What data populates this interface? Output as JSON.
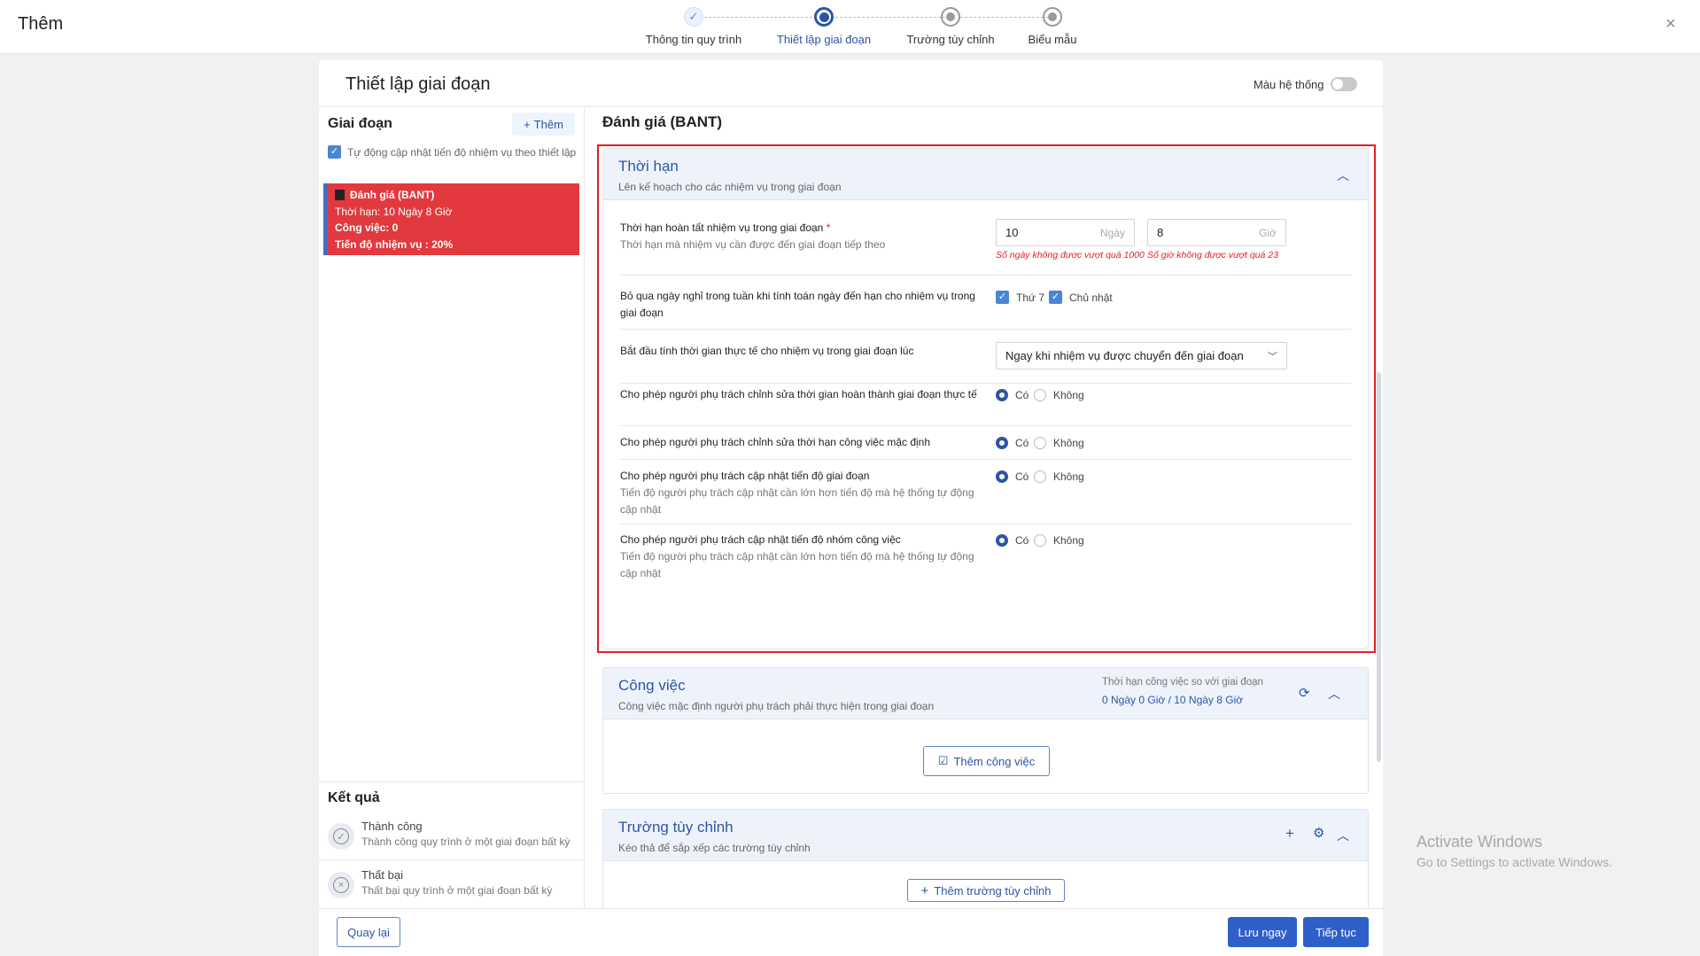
{
  "modal": {
    "title": "Thêm",
    "close": "×"
  },
  "steps": [
    {
      "label": "Thông tin quy trình",
      "state": "done"
    },
    {
      "label": "Thiết lập giai đoạn",
      "state": "active"
    },
    {
      "label": "Trường tùy chỉnh",
      "state": "pending"
    },
    {
      "label": "Biểu mẫu",
      "state": "pending"
    }
  ],
  "card": {
    "title": "Thiết lập giai đoạn",
    "system_color_label": "Màu hệ thống"
  },
  "left": {
    "heading": "Giai đoạn",
    "add_button": "Thêm",
    "add_icon": "+",
    "auto_update_label": "Tự động cập nhật tiến độ nhiệm vụ theo thiết lập",
    "stage": {
      "name": "Đánh giá (BANT)",
      "deadline": "Thời hạn: 10 Ngày 8 Giờ",
      "tasks": "Công việc: 0",
      "progress": "Tiến độ nhiệm vụ :  20%",
      "color": "#e2393e"
    },
    "results": {
      "heading": "Kết quả",
      "success": {
        "title": "Thành công",
        "desc": "Thành công quy trình ở một giai đoạn bất kỳ"
      },
      "fail": {
        "title": "Thất bại",
        "desc": "Thất bại quy trình ở một giai đoạn bất kỳ"
      }
    }
  },
  "stage_title": "Đánh giá (BANT)",
  "deadline_section": {
    "title": "Thời hạn",
    "subtitle": "Lên kế hoạch cho các nhiệm vụ trong giai đoạn",
    "complete_label": "Thời hạn hoàn tất nhiệm vụ trong giai đoạn",
    "required_mark": "*",
    "complete_sub": "Thời hạn mà nhiệm vụ cần được đến giai đoạn tiếp theo",
    "days_value": "10",
    "days_unit": "Ngày",
    "days_error": "Số ngày không được vượt quá 1000",
    "hours_value": "8",
    "hours_unit": "Giờ",
    "hours_error": "Số giờ không được vượt quá 23",
    "skip_label": "Bỏ qua ngày nghỉ trong tuần khi tính toán ngày đến hạn cho nhiệm vụ trong giai đoạn",
    "skip_sat": "Thứ 7",
    "skip_sun": "Chủ nhật",
    "start_label": "Bắt đầu tính thời gian thực tế cho nhiệm vụ trong giai đoạn lúc",
    "start_value": "Ngay khi nhiệm vụ được chuyển đến giai đoạn",
    "yes": "Có",
    "no": "Không",
    "q1": "Cho phép người phụ trách chỉnh sửa thời gian hoàn thành giai đoạn thực tế",
    "q2": "Cho phép người phụ trách chỉnh sửa thời hạn công việc mặc định",
    "q3": "Cho phép người phụ trách cập nhật tiến độ giai đoạn",
    "q3_sub": "Tiến độ người phụ trách cập nhật cần lớn hơn tiến độ mà hệ thống tự động cập nhật",
    "q4": "Cho phép người phụ trách cập nhật tiến độ nhóm công việc",
    "q4_sub": "Tiến độ người phụ trách cập nhật cần lớn hơn tiến độ mà hệ thống tự động cập nhật"
  },
  "tasks_section": {
    "title": "Công việc",
    "subtitle": "Công việc mặc định người phụ trách phải thực hiện trong giai đoạn",
    "compare_label": "Thời hạn công việc so với giai đoạn",
    "compare_value": "0 Ngày 0 Giờ / 10 Ngày 8 Giờ",
    "add_button": "Thêm công việc"
  },
  "custom_section": {
    "title": "Trường tùy chỉnh",
    "subtitle": "Kéo thả để sắp xếp các trường tùy chỉnh",
    "add_button": "Thêm trường tùy chỉnh"
  },
  "footer": {
    "back": "Quay lại",
    "save": "Lưu ngay",
    "next": "Tiếp tục"
  },
  "watermark": {
    "line1": "Activate Windows",
    "line2": "Go to Settings to activate Windows."
  }
}
